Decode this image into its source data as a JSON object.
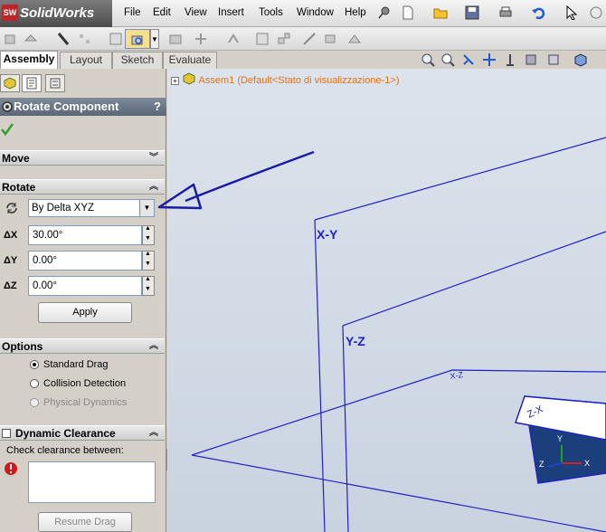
{
  "app": {
    "name": "SolidWorks",
    "logo_letters": "SW"
  },
  "menu": [
    "File",
    "Edit",
    "View",
    "Insert",
    "Tools",
    "Window",
    "Help"
  ],
  "tabs": [
    {
      "label": "Assembly",
      "active": true
    },
    {
      "label": "Layout",
      "active": false
    },
    {
      "label": "Sketch",
      "active": false
    },
    {
      "label": "Evaluate",
      "active": false
    }
  ],
  "property_manager": {
    "title": "Rotate Component",
    "help": "?",
    "sections": {
      "move": "Move",
      "rotate": "Rotate",
      "options": "Options",
      "dynamic_clearance": "Dynamic Clearance"
    },
    "rotate": {
      "mode_selected": "By Delta XYZ",
      "dx_label": "X",
      "dy_label": "Y",
      "dz_label": "Z",
      "dx": "30.00°",
      "dy": "0.00°",
      "dz": "0.00°",
      "apply": "Apply"
    },
    "options": {
      "standard_drag": "Standard Drag",
      "collision_detection": "Collision Detection",
      "physical_dynamics": "Physical Dynamics",
      "selected": "standard_drag"
    },
    "clearance": {
      "check_label": "Check clearance between:",
      "resume_drag": "Resume Drag"
    }
  },
  "tree": {
    "root": "Assem1",
    "config": "(Default<Stato di visualizzazione-1>)"
  },
  "viewport": {
    "planes": {
      "front": "X-Y",
      "right": "Y-Z",
      "top": "X-Z"
    },
    "part_label": "Z-X",
    "triad": {
      "x": "X",
      "y": "Y",
      "z": "Z"
    }
  },
  "colors": {
    "plane_blue": "#2020c8",
    "annotation_arrow": "#1a1aa8",
    "tree_orange": "#e0721a",
    "header_bg": "#5b6676"
  }
}
